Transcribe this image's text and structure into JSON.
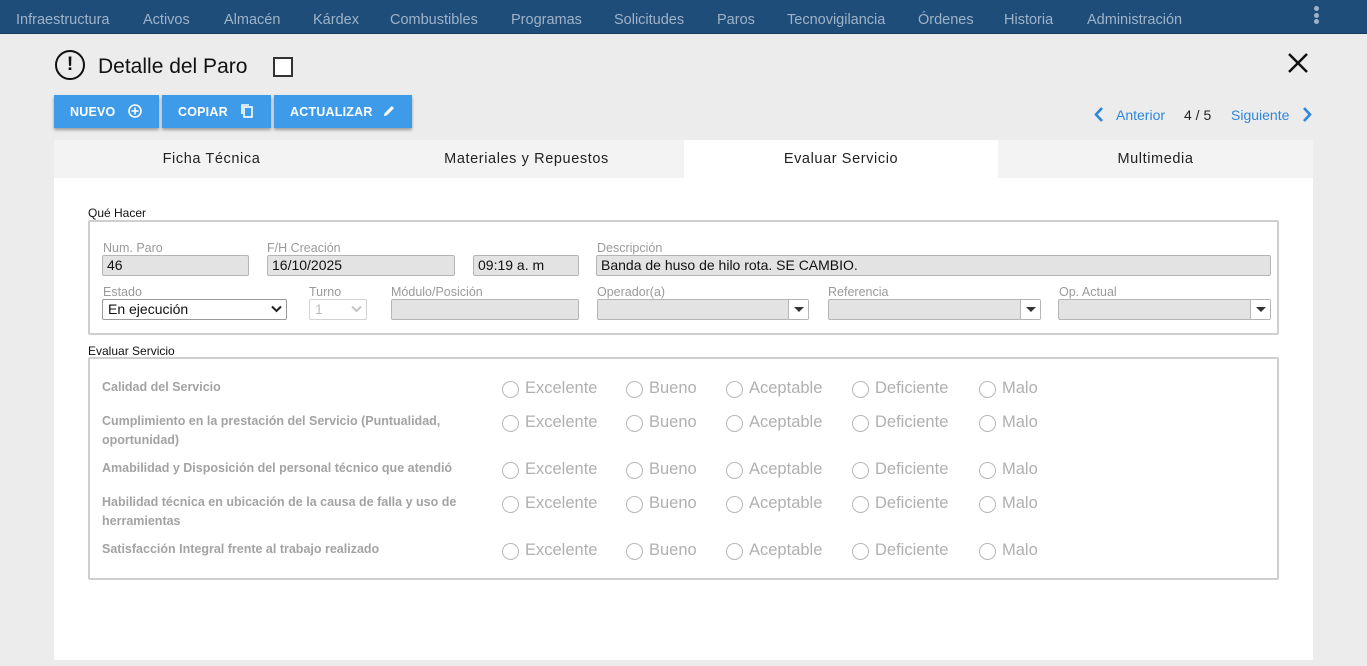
{
  "nav": {
    "items": [
      "Infraestructura",
      "Activos",
      "Almacén",
      "Kárdex",
      "Combustibles",
      "Programas",
      "Solicitudes",
      "Paros",
      "Tecnovigilancia",
      "Órdenes",
      "Historia",
      "Administración"
    ]
  },
  "header": {
    "title": "Detalle del Paro"
  },
  "toolbar": {
    "new_label": "NUEVO",
    "copy_label": "COPIAR",
    "update_label": "ACTUALIZAR"
  },
  "pager": {
    "prev_label": "Anterior",
    "count": "4 / 5",
    "next_label": "Siguiente"
  },
  "tabs": [
    {
      "label": "Ficha Técnica",
      "active": false
    },
    {
      "label": "Materiales y Repuestos",
      "active": false
    },
    {
      "label": "Evaluar Servicio",
      "active": true
    },
    {
      "label": "Multimedia",
      "active": false
    }
  ],
  "que_hacer": {
    "title": "Qué Hacer",
    "num_paro": {
      "label": "Num. Paro",
      "value": "46"
    },
    "creacion": {
      "label": "F/H Creación",
      "date": "16/10/2025",
      "time": "09:19 a. m"
    },
    "descripcion": {
      "label": "Descripción",
      "value": "Banda de huso de hilo rota. SE CAMBIO."
    },
    "estado": {
      "label": "Estado",
      "value": "En ejecución"
    },
    "turno": {
      "label": "Turno",
      "value": "1"
    },
    "modulo": {
      "label": "Módulo/Posición",
      "value": ""
    },
    "operador": {
      "label": "Operador(a)",
      "value": ""
    },
    "referencia": {
      "label": "Referencia",
      "value": ""
    },
    "op_actual": {
      "label": "Op. Actual",
      "value": ""
    }
  },
  "evaluar": {
    "title": "Evaluar Servicio",
    "options": [
      "Excelente",
      "Bueno",
      "Aceptable",
      "Deficiente",
      "Malo"
    ],
    "questions": [
      "Calidad del Servicio",
      "Cumplimiento en la prestación del Servicio (Puntualidad, oportunidad)",
      "Amabilidad y Disposición del personal técnico que atendió",
      "Habilidad técnica en ubicación de la causa de falla y uso de herramientas",
      "Satisfacción Integral frente al trabajo realizado"
    ]
  },
  "colors": {
    "nav_bg": "#1f4d7a",
    "nav_text": "#9fb3c8",
    "button_bg": "#3d9be9",
    "link": "#2e86de",
    "disabled_text": "#b0b0b0"
  }
}
